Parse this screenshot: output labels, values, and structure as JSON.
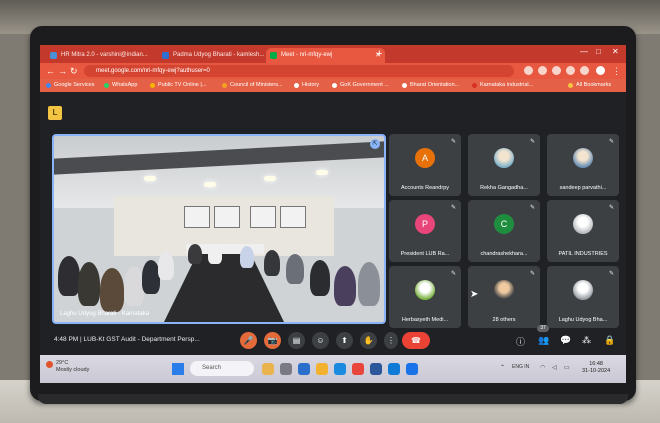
{
  "browser": {
    "tabs": [
      {
        "label": "HR Mitra 2.0 - varshini@indian...",
        "color": "#4a90d9"
      },
      {
        "label": "Padma Udyog Bharati - kamlesh...",
        "color": "#2e6fd1"
      },
      {
        "label": "Meet - nri-mfqy-ewj",
        "color": "#00ac47"
      }
    ],
    "url": "meet.google.com/nri-mfqy-ewj?authuser=0",
    "bookmarks": [
      {
        "label": "Google Services",
        "color": "#4285f4"
      },
      {
        "label": "WhatsApp",
        "color": "#25d366"
      },
      {
        "label": "Public TV Online |...",
        "color": "#f5b400"
      },
      {
        "label": "Council of Ministers...",
        "color": "#f4a020"
      },
      {
        "label": "History",
        "color": "#ffffff"
      },
      {
        "label": "GoK Government ...",
        "color": "#ffffff"
      },
      {
        "label": "Bharat Orientation...",
        "color": "#ffffff"
      },
      {
        "label": "Karnataka industrial...",
        "color": "#d93025"
      },
      {
        "label": "All Bookmarks",
        "color": "#f4c542"
      }
    ]
  },
  "meet": {
    "logo": "L",
    "main_tile": {
      "label": "Laghu Udyog Bharati - Karnataka"
    },
    "participants": [
      {
        "name": "Accounts Reandrpy",
        "initial": "A",
        "color": "#e8710a",
        "photo": false
      },
      {
        "name": "Rekha Gangadha...",
        "initial": "",
        "color": "#7fb3c8",
        "photo": true
      },
      {
        "name": "sandeep parvathi...",
        "initial": "",
        "color": "#6a8fb5",
        "photo": true
      },
      {
        "name": "President LUB Ra...",
        "initial": "P",
        "color": "#e8457a",
        "photo": false
      },
      {
        "name": "chandrashekhara...",
        "initial": "C",
        "color": "#1e8e3e",
        "photo": false
      },
      {
        "name": "PATIL INDUSTRIES",
        "initial": "",
        "color": "#b9bcc0",
        "photo": true
      },
      {
        "name": "Herbasyeth Medi...",
        "initial": "",
        "color": "#7cb342",
        "photo": true
      },
      {
        "name": "28 others",
        "initial": "",
        "color": "#f0c9a0",
        "photo": true
      },
      {
        "name": "Laghu Udyog Bha...",
        "initial": "",
        "color": "#cfd3d6",
        "photo": true
      }
    ],
    "time": "4:48 PM",
    "separator": "|",
    "meeting_title": "LUB-Kt GST Audit - Department Persp...",
    "participants_badge": "37",
    "controls": {
      "mic": "🎤",
      "camera": "📷",
      "captions": "▤",
      "emoji": "☺",
      "present": "⬆",
      "hand": "✋",
      "more": "⋮",
      "leave": "☎",
      "info": "ⓘ",
      "people": "👥",
      "chat": "💬",
      "activities": "⁂",
      "host": "🔒"
    }
  },
  "taskbar": {
    "weather_temp": "29°C",
    "weather_desc": "Mostly cloudy",
    "search_placeholder": "Search",
    "date": "31-10-2024",
    "clock": "16:48",
    "lang": "ENG IN"
  }
}
